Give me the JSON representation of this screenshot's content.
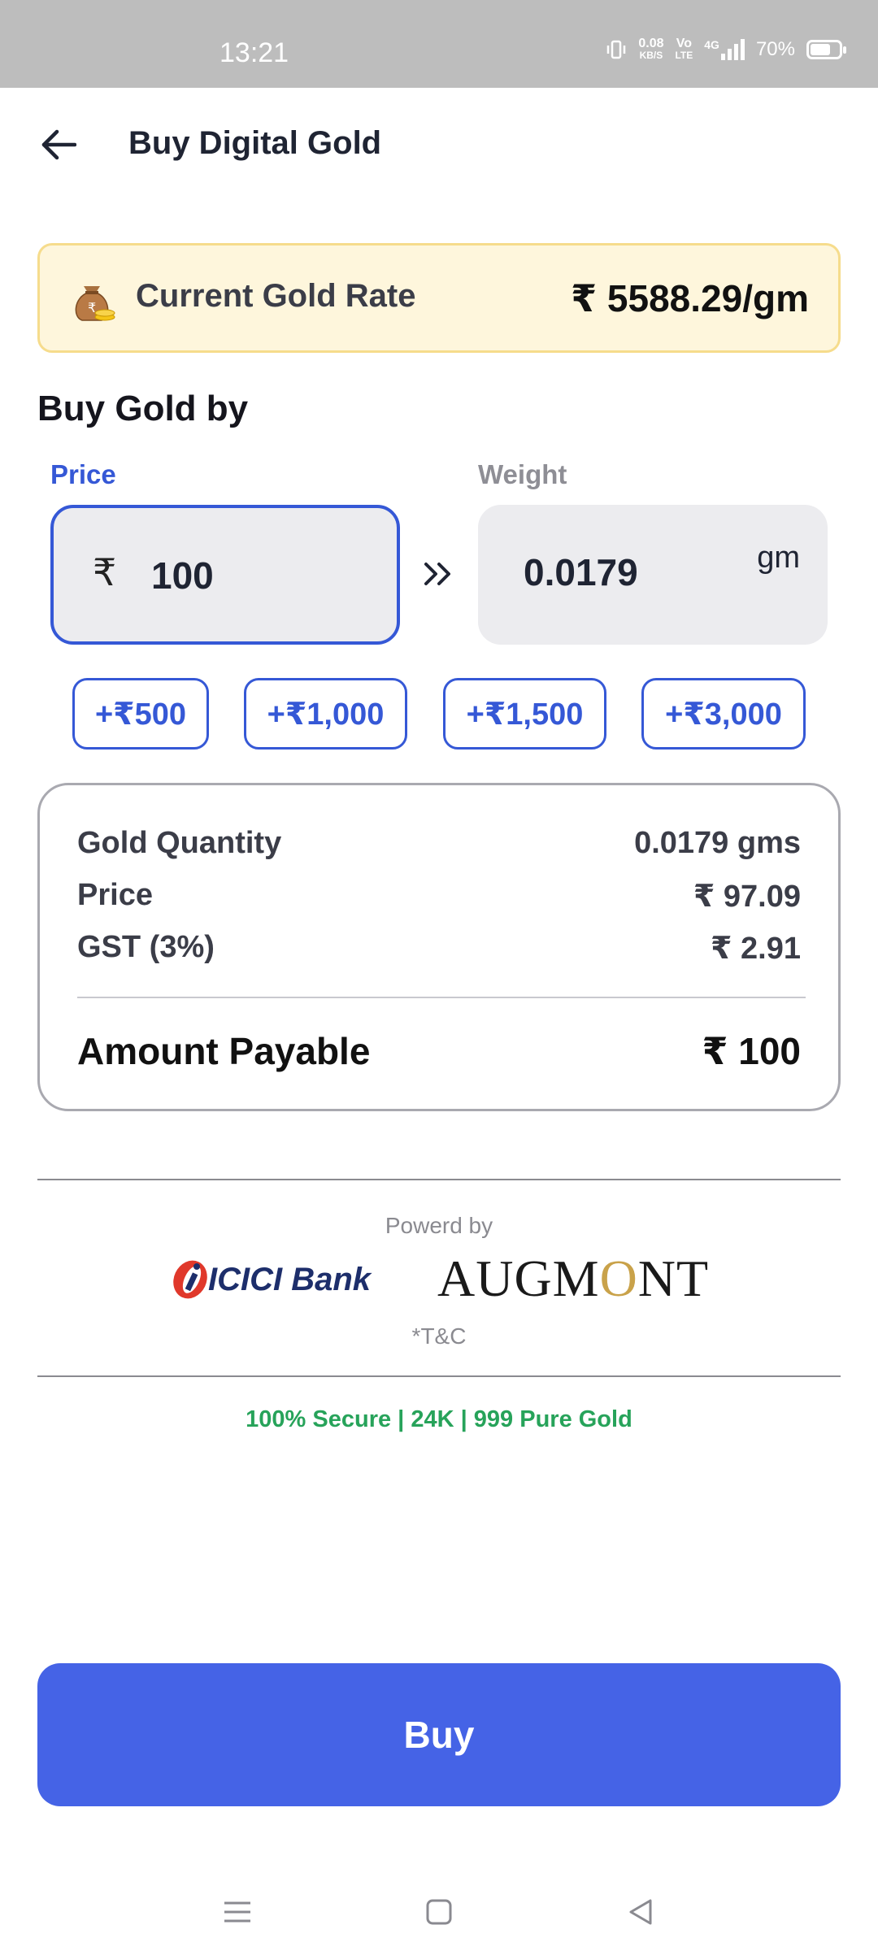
{
  "status_bar": {
    "time": "13:21",
    "net_speed_top": "0.08",
    "net_speed_bottom": "KB/S",
    "volte_top": "Vo",
    "volte_bottom": "LTE",
    "network": "4G",
    "battery": "70%",
    "battery_level": 0.7
  },
  "header": {
    "title": "Buy Digital Gold",
    "back_icon": "arrow-left-icon"
  },
  "rate_card": {
    "label": "Current Gold Rate",
    "value": "₹ 5588.29/gm",
    "icon": "money-bag-icon"
  },
  "buy_by": {
    "title": "Buy Gold by",
    "price_tab": "Price",
    "weight_tab": "Weight",
    "price_prefix": "₹",
    "price_value": "100",
    "weight_value": "0.0179",
    "weight_unit": "gm",
    "quick_amounts": [
      "+₹500",
      "+₹1,000",
      "+₹1,500",
      "+₹3,000"
    ]
  },
  "summary": {
    "rows": [
      {
        "label": "Gold Quantity",
        "value": "0.0179 gms"
      },
      {
        "label": "Price",
        "value": "₹ 97.09"
      },
      {
        "label": "GST (3%)",
        "value": "₹ 2.91"
      }
    ],
    "payable_label": "Amount Payable",
    "payable_value": "₹ 100"
  },
  "footer": {
    "powered_by": "Powerd by",
    "partner_1": "ICICI Bank",
    "partner_2": "AUGMONT",
    "tnc": "*T&C",
    "secure": "100% Secure | 24K | 999 Pure Gold"
  },
  "buy_button": "Buy",
  "colors": {
    "accent": "#4563e6",
    "gold_bg": "#fef6dc",
    "secure_green": "#27a35a"
  }
}
